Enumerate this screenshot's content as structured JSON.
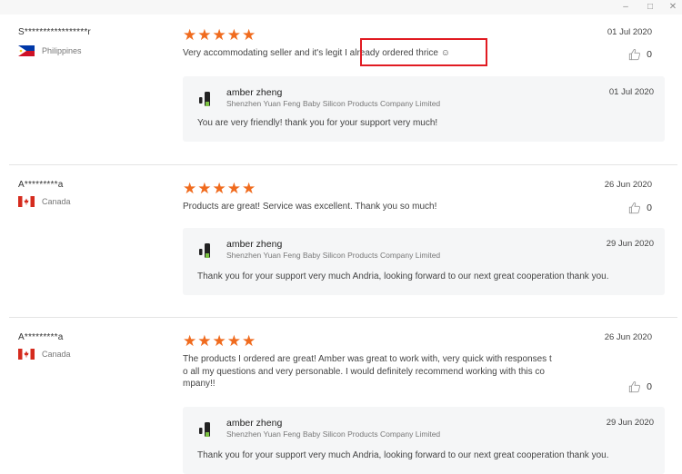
{
  "window": {
    "minimize_glyph": "–",
    "maximize_glyph": "□",
    "close_glyph": "✕"
  },
  "colors": {
    "star": "#f06b1e",
    "highlight": "#e11b22",
    "reply_bg": "#f5f6f7"
  },
  "reviews": [
    {
      "buyer": "S*****************r",
      "country": "Philippines",
      "flag_icon": "philippines-flag-icon",
      "rating": 5,
      "stars": "★★★★★",
      "date": "01 Jul 2020",
      "text_before": "Very accommodating seller and it's legit ",
      "text_highlight": "I already ordered thrice ☺",
      "likes": "0",
      "reply": {
        "seller": "amber zheng",
        "company": "Shenzhen Yuan Feng Baby Silicon Products Company Limited",
        "date": "01 Jul 2020",
        "text": "You are very friendly! thank you for your support very much!"
      }
    },
    {
      "buyer": "A*********a",
      "country": "Canada",
      "flag_icon": "canada-flag-icon",
      "rating": 5,
      "stars": "★★★★★",
      "date": "26 Jun 2020",
      "text": "Products are great! Service was excellent. Thank you so much!",
      "likes": "0",
      "reply": {
        "seller": "amber zheng",
        "company": "Shenzhen Yuan Feng Baby Silicon Products Company Limited",
        "date": "29 Jun 2020",
        "text": "Thank you for your support very much Andria, looking forward to our next great cooperation thank you."
      }
    },
    {
      "buyer": "A*********a",
      "country": "Canada",
      "flag_icon": "canada-flag-icon",
      "rating": 5,
      "stars": "★★★★★",
      "date": "26 Jun 2020",
      "text_lines": [
        "The products I ordered are great! Amber was great to work with, very quick with responses t",
        "o all my questions and very personable. I would definitely recommend working with this co",
        "mpany!!"
      ],
      "likes": "0",
      "reply": {
        "seller": "amber zheng",
        "company": "Shenzhen Yuan Feng Baby Silicon Products Company Limited",
        "date": "29 Jun 2020",
        "text": "Thank you for your support very much Andria, looking forward to our next great cooperation thank you."
      }
    }
  ]
}
